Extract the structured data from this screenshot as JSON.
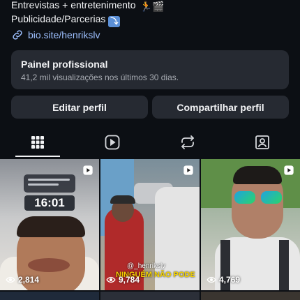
{
  "bio": {
    "line1": "Entrevistas + entretenimento",
    "line1_emoji": "🏃🎬",
    "line2": "Publicidade/Parcerias",
    "line2_emoji": "⤵",
    "link": "bio.site/henrikslv"
  },
  "dashboard": {
    "title": "Painel profissional",
    "subtitle": "41,2 mil visualizações nos últimos 30 dias."
  },
  "actions": {
    "edit_label": "Editar perfil",
    "share_label": "Compartilhar perfil"
  },
  "tabs": [
    {
      "name": "grid",
      "active": true
    },
    {
      "name": "reels",
      "active": false
    },
    {
      "name": "reposts",
      "active": false
    },
    {
      "name": "tagged",
      "active": false
    }
  ],
  "posts": [
    {
      "views": "2,814",
      "overlay_time": "16:01"
    },
    {
      "views": "9,784",
      "overlay_handle": "@_henrikslv",
      "overlay_caption": "NINGUÉM NÃO PODE"
    },
    {
      "views": "4,769"
    }
  ],
  "colors": {
    "background": "#0c0f14",
    "card": "#262a32",
    "link": "#9ec0ff",
    "text": "#f2f3f5",
    "muted": "#a8acb3"
  }
}
